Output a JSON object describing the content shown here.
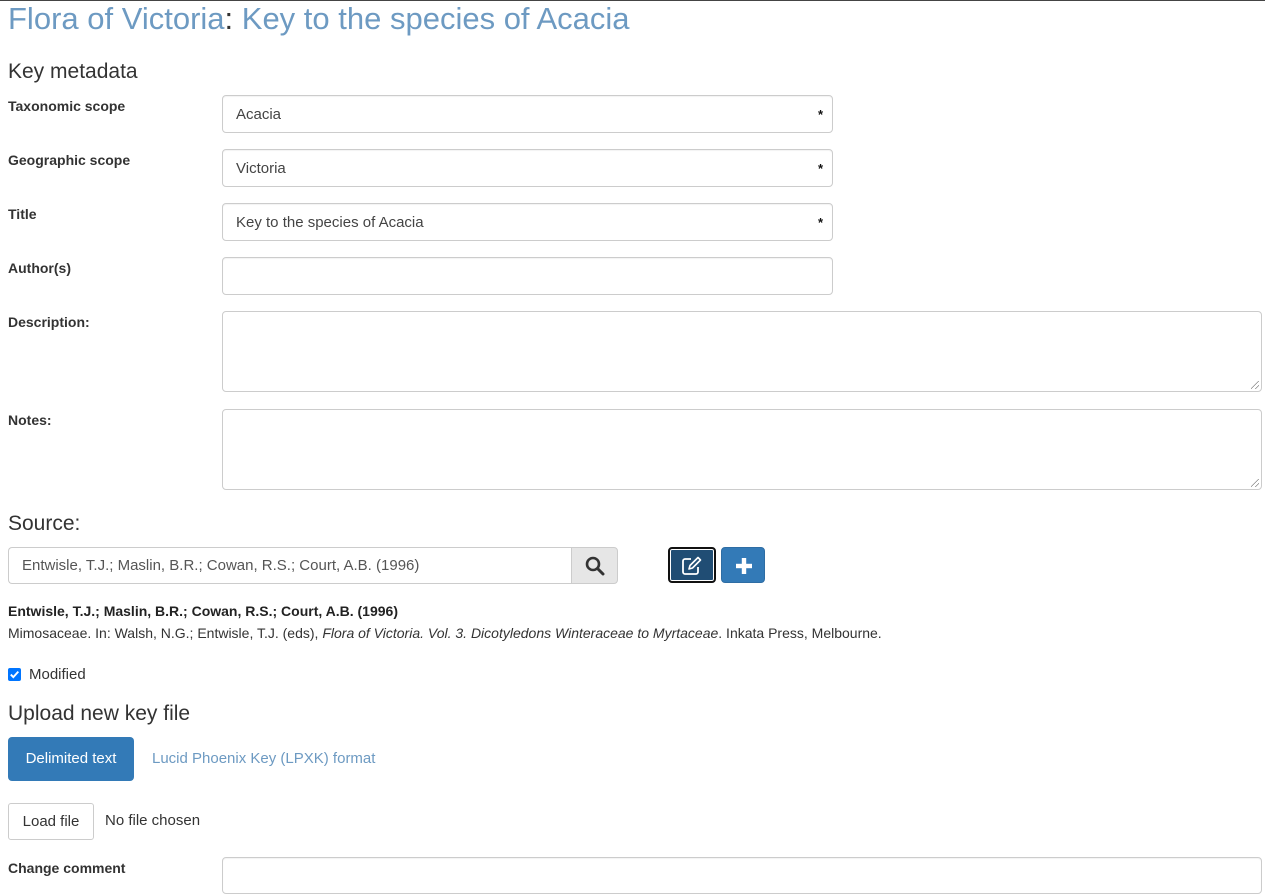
{
  "header": {
    "site_link": "Flora of Victoria",
    "separator": ":",
    "page_link": "Key to the species of Acacia"
  },
  "metadata": {
    "heading": "Key metadata",
    "fields": {
      "taxonomic_scope": {
        "label": "Taxonomic scope",
        "value": "Acacia",
        "required_marker": "*"
      },
      "geographic_scope": {
        "label": "Geographic scope",
        "value": "Victoria",
        "required_marker": "*"
      },
      "title": {
        "label": "Title",
        "value": "Key to the species of Acacia",
        "required_marker": "*"
      },
      "authors": {
        "label": "Author(s)",
        "value": ""
      },
      "description": {
        "label": "Description:",
        "value": ""
      },
      "notes": {
        "label": "Notes:",
        "value": ""
      }
    }
  },
  "source": {
    "heading": "Source:",
    "search_value": "Entwisle, T.J.; Maslin, B.R.; Cowan, R.S.; Court, A.B. (1996)",
    "search_icon": "search-icon",
    "edit_icon": "edit-icon",
    "add_icon": "plus-icon",
    "reference": {
      "authors_year": "Entwisle, T.J.; Maslin, B.R.; Cowan, R.S.; Court, A.B. (1996)",
      "text_before": "Mimosaceae. In: Walsh, N.G.; Entwisle, T.J. (eds), ",
      "work_title": "Flora of Victoria. Vol. 3. Dicotyledons Winteraceae to Myrtaceae",
      "text_after": ". Inkata Press, Melbourne."
    },
    "modified_label": "Modified",
    "modified_checked": true
  },
  "upload": {
    "heading": "Upload new key file",
    "tabs": [
      "Delimited text",
      "Lucid Phoenix Key (LPXK) format"
    ],
    "load_button": "Load file",
    "file_status": "No file chosen"
  },
  "change_comment": {
    "label": "Change comment",
    "value": ""
  },
  "colors": {
    "link": "#6d9ac2",
    "primary": "#337ab7",
    "primary_dark": "#204d74"
  }
}
